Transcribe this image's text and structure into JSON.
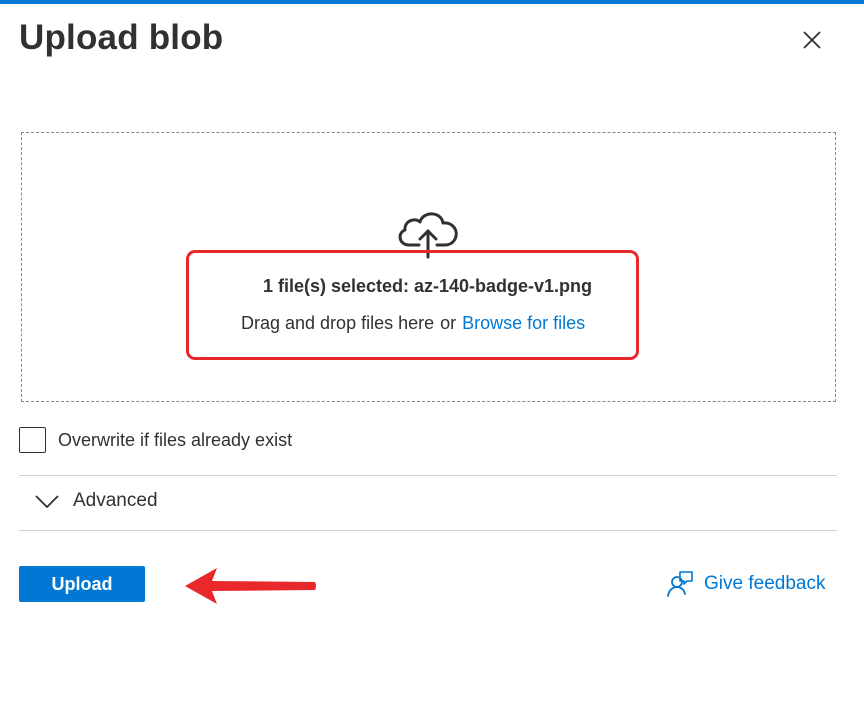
{
  "dialog": {
    "title": "Upload blob",
    "close_icon": "close-icon"
  },
  "dropzone": {
    "icon": "cloud-upload-icon",
    "selected_text": "1 file(s) selected: az-140-badge-v1.png",
    "drag_text": "Drag and drop files here",
    "or_text": "or",
    "browse_label": "Browse for files"
  },
  "overwrite": {
    "label": "Overwrite if files already exist",
    "checked": false
  },
  "advanced": {
    "label": "Advanced",
    "icon": "chevron-down-icon"
  },
  "actions": {
    "upload_label": "Upload",
    "feedback_label": "Give feedback",
    "feedback_icon": "feedback-person-icon"
  },
  "colors": {
    "accent": "#0078d4",
    "annotation_red": "#e8282b",
    "text": "#323130"
  }
}
